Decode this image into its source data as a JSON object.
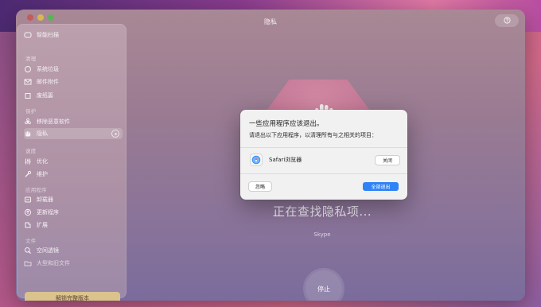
{
  "window": {
    "title": "隐私"
  },
  "sidebar": {
    "smart_scan": "智能扫描",
    "sections": {
      "cleanup": "清理",
      "protection": "保护",
      "speed": "速度",
      "apps": "应用程序",
      "files": "文件"
    },
    "items": {
      "system_junk": "系统垃圾",
      "mail_attachments": "邮件附件",
      "trash": "废纸篓",
      "malware": "移除恶意软件",
      "privacy": "隐私",
      "optimize": "优化",
      "maintenance": "维护",
      "uninstaller": "卸载器",
      "updater": "更新程序",
      "extensions": "扩展",
      "space_lens": "空间透镜",
      "large_old_files": "大型和旧文件"
    },
    "unlock_label": "解锁完整版本"
  },
  "main": {
    "status": "正在查找隐私项...",
    "current_app": "Skype",
    "stop_label": "停止"
  },
  "dialog": {
    "title": "一些应用程序应该退出。",
    "subtitle": "请退出以下应用程序，以清理所有与之相关的项目：",
    "app_name": "Safari浏览器",
    "close_label": "关闭",
    "ignore_label": "忽略",
    "quit_all_label": "全部退出"
  },
  "colors": {
    "accent_blue": "#2f83f5",
    "unlock_gold": "#dbc38e"
  },
  "icons": {
    "help": "help-icon",
    "search": "search-icon"
  }
}
